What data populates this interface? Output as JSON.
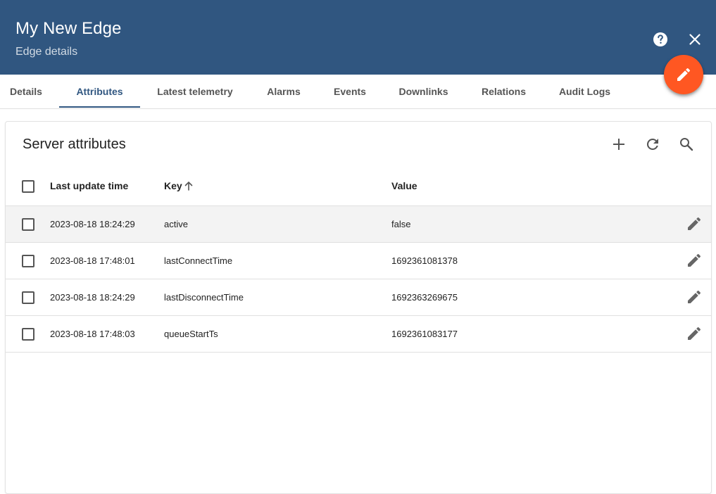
{
  "header": {
    "title": "My New Edge",
    "subtitle": "Edge details",
    "color": "#305680"
  },
  "fab": {
    "icon": "pencil-icon",
    "color": "#ff5722"
  },
  "tabs": [
    {
      "label": "Details"
    },
    {
      "label": "Attributes",
      "active": true
    },
    {
      "label": "Latest telemetry"
    },
    {
      "label": "Alarms"
    },
    {
      "label": "Events"
    },
    {
      "label": "Downlinks"
    },
    {
      "label": "Relations"
    },
    {
      "label": "Audit Logs"
    }
  ],
  "card": {
    "title": "Server attributes",
    "tools": [
      "add-icon",
      "refresh-icon",
      "search-icon"
    ]
  },
  "table": {
    "columns": [
      "Last update time",
      "Key",
      "Value"
    ],
    "sort": {
      "column": "Key",
      "direction": "ascending"
    },
    "rows": [
      {
        "time": "2023-08-18 18:24:29",
        "key": "active",
        "value": "false"
      },
      {
        "time": "2023-08-18 17:48:01",
        "key": "lastConnectTime",
        "value": "1692361081378"
      },
      {
        "time": "2023-08-18 18:24:29",
        "key": "lastDisconnectTime",
        "value": "1692363269675"
      },
      {
        "time": "2023-08-18 17:48:03",
        "key": "queueStartTs",
        "value": "1692361083177"
      }
    ]
  }
}
